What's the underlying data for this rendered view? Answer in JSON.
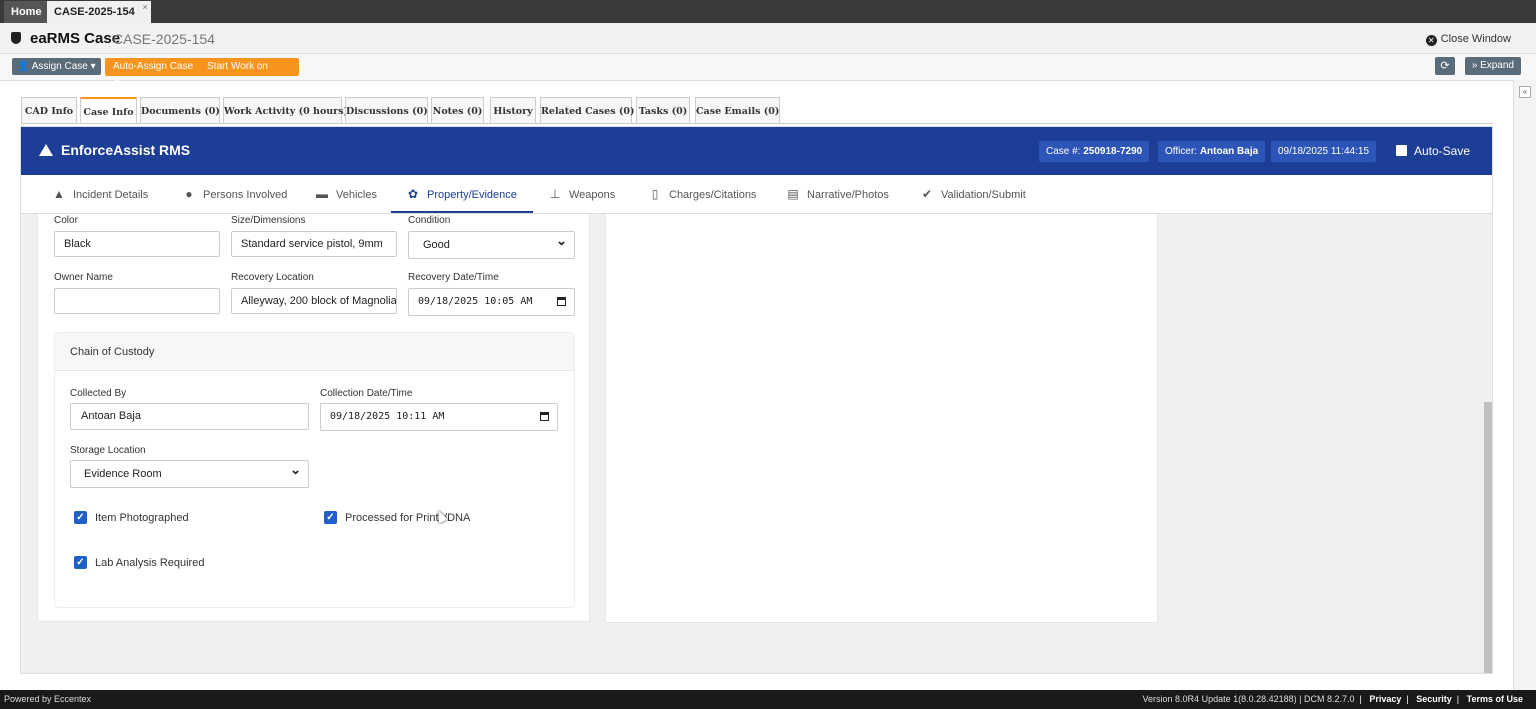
{
  "top_tabs": {
    "home": "Home",
    "case": "CASE-2025-154",
    "close": "×"
  },
  "title": {
    "app": "eaRMS Case",
    "case_id": "CASE-2025-154",
    "close_window": "Close Window"
  },
  "actions": {
    "assign": "Assign Case ▾",
    "auto_assign": "Auto-Assign Case",
    "start_work": "Start Work on Case",
    "expand": "Expand"
  },
  "page_tabs": [
    "CAD Info",
    "Case Info",
    "Documents (0)",
    "Work Activity (0 hours)",
    "Discussions (0)",
    "Notes (0)",
    "History",
    "Related Cases (0)",
    "Tasks (0)",
    "Case Emails (0)"
  ],
  "rms": {
    "logo": "EnforceAssist RMS",
    "case_label": "Case #:",
    "case_number": "250918-7290",
    "officer_label": "Officer:",
    "officer_name": "Antoan Baja",
    "datetime": "09/18/2025 11:44:15",
    "autosave": "Auto-Save"
  },
  "nav": [
    {
      "label": "Incident Details",
      "icon": "warning-icon"
    },
    {
      "label": "Persons Involved",
      "icon": "person-icon"
    },
    {
      "label": "Vehicles",
      "icon": "car-icon"
    },
    {
      "label": "Property/Evidence",
      "icon": "gear-icon"
    },
    {
      "label": "Weapons",
      "icon": "weapon-icon"
    },
    {
      "label": "Charges/Citations",
      "icon": "document-icon"
    },
    {
      "label": "Narrative/Photos",
      "icon": "notes-icon"
    },
    {
      "label": "Validation/Submit",
      "icon": "check-circle-icon"
    }
  ],
  "form": {
    "color_label": "Color",
    "color_value": "Black",
    "size_label": "Size/Dimensions",
    "size_value": "Standard service pistol, 9mm",
    "condition_label": "Condition",
    "condition_value": "Good",
    "owner_label": "Owner Name",
    "owner_value": "",
    "recovery_loc_label": "Recovery Location",
    "recovery_loc_value": "Alleyway, 200 block of Magnolia",
    "recovery_dt_label": "Recovery Date/Time",
    "recovery_dt_value": "09/18/2025 10:05 AM"
  },
  "custody": {
    "title": "Chain of Custody",
    "collected_by_label": "Collected By",
    "collected_by_value": "Antoan Baja",
    "collection_dt_label": "Collection Date/Time",
    "collection_dt_value": "09/18/2025 10:11 AM",
    "storage_label": "Storage Location",
    "storage_value": "Evidence Room",
    "checkboxes": [
      {
        "label": "Item Photographed",
        "checked": true
      },
      {
        "label": "Processed for Prints/DNA",
        "checked": true
      },
      {
        "label": "Lab Analysis Required",
        "checked": true
      }
    ]
  },
  "footer": {
    "powered": "Powered by Eccentex",
    "version": "Version  8.0R4 Update 1(8.0.28.42188) | DCM 8.2.7.0",
    "privacy": "Privacy",
    "security": "Security",
    "terms": "Terms of Use"
  }
}
